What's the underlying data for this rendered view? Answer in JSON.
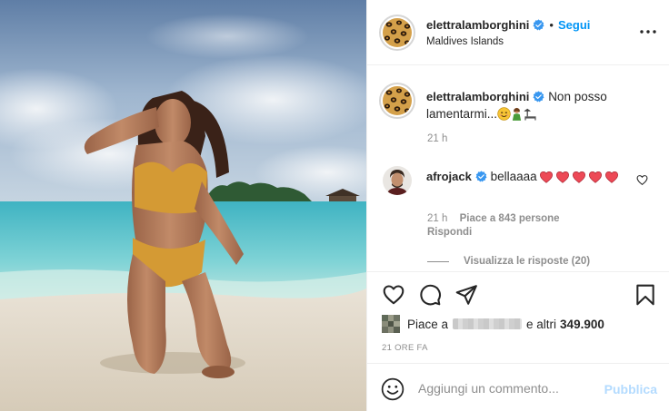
{
  "post": {
    "photo_icon": "beach-photo",
    "author": {
      "username": "elettralamborghini",
      "verified": true,
      "avatar_icon": "leopard-print-avatar"
    },
    "follow_label": "Segui",
    "separator": "•",
    "location": "Maldives Islands",
    "more_icon": "more-options-icon"
  },
  "caption": {
    "username": "elettralamborghini",
    "text": "Non posso lamentarmi...",
    "emojis": [
      "smiling-face-emoji",
      "woman-emoji",
      "beach-bed-emoji"
    ],
    "time": "21 h"
  },
  "comments": [
    {
      "username": "afrojack",
      "verified": true,
      "text": "bellaaaa",
      "hearts": 5,
      "time": "21 h",
      "likes_text": "Piace a 843 persone",
      "reply_label": "Rispondi",
      "view_replies": "Visualizza le risposte (20)"
    }
  ],
  "actions": {
    "like_icon": "heart-icon",
    "comment_icon": "comment-icon",
    "share_icon": "paper-plane-icon",
    "save_icon": "bookmark-icon"
  },
  "likes": {
    "prefix": "Piace a",
    "middle": "e altri",
    "count": "349.900"
  },
  "post_time": "21 ORE FA",
  "composer": {
    "emoji_icon": "smiley-icon",
    "placeholder": "Aggiungi un commento...",
    "publish_label": "Pubblica"
  },
  "colors": {
    "accent": "#0095f6",
    "publish_disabled": "#b3dbff",
    "heart_red": "#ed4956",
    "muted": "#8e8e8e",
    "text": "#262626"
  }
}
